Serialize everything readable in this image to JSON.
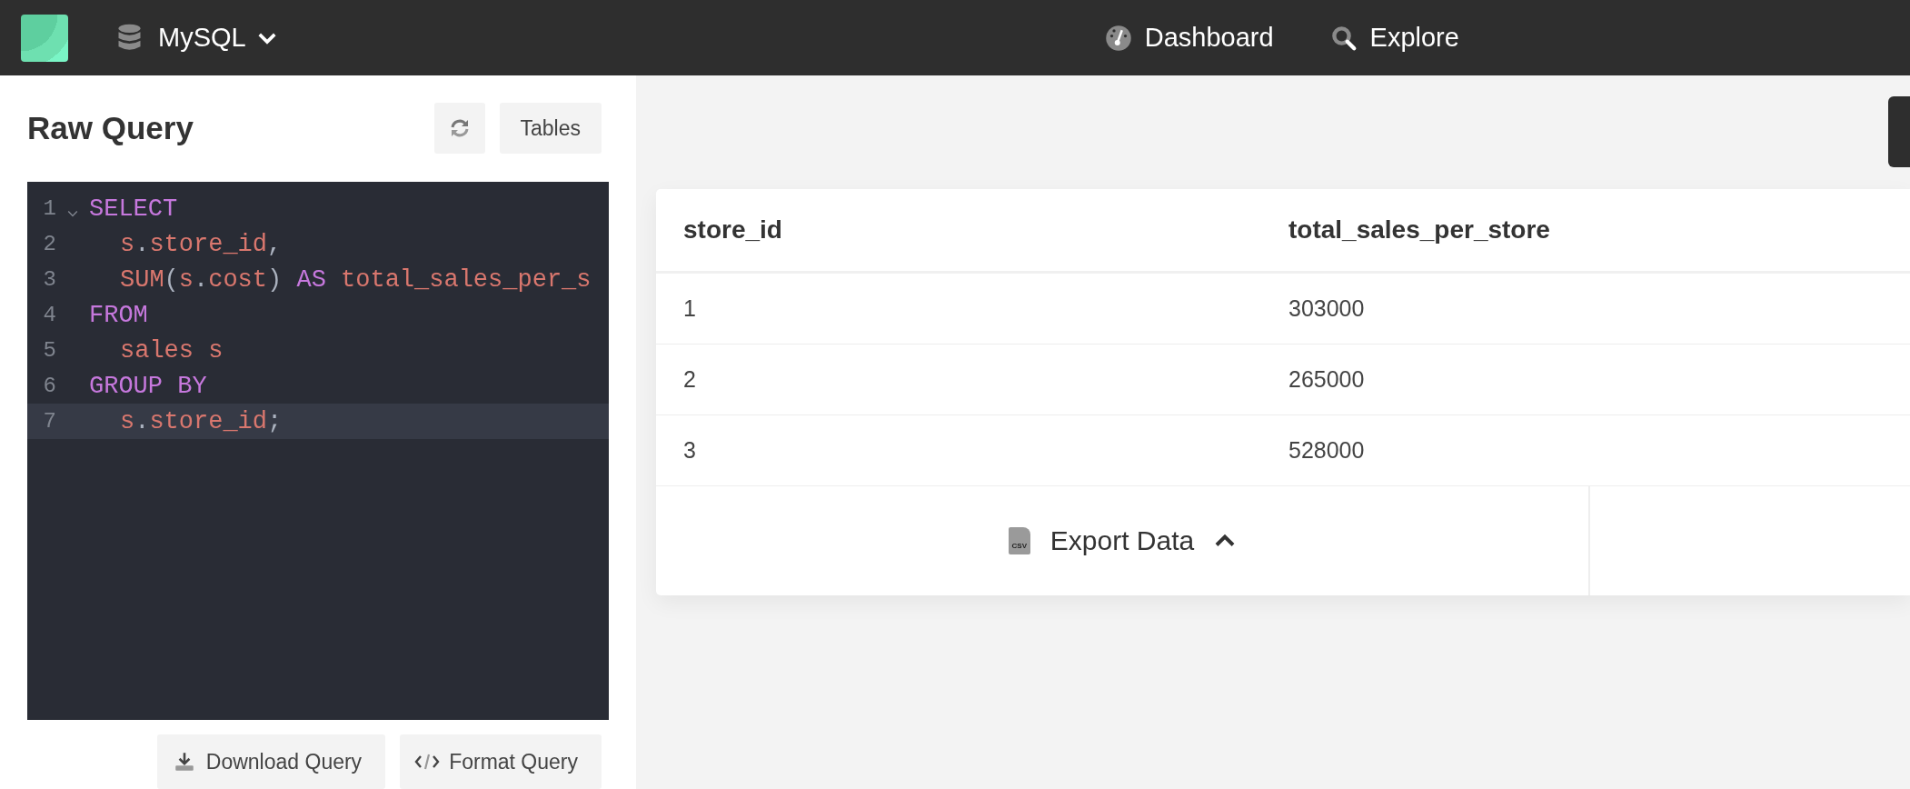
{
  "topbar": {
    "database": "MySQL",
    "nav": [
      {
        "label": "Dashboard",
        "kind": "dashboard"
      },
      {
        "label": "Explore",
        "kind": "explore"
      }
    ]
  },
  "query_panel": {
    "title": "Raw Query",
    "tables_button": "Tables",
    "editor": {
      "lines": [
        {
          "number": "1",
          "foldable": true,
          "active": false,
          "indented": false,
          "tokens": [
            {
              "kind": "keyword",
              "text": "SELECT"
            }
          ]
        },
        {
          "number": "2",
          "foldable": false,
          "active": false,
          "indented": true,
          "tokens": [
            {
              "kind": "ident",
              "text": "s"
            },
            {
              "kind": "punct",
              "text": "."
            },
            {
              "kind": "ident",
              "text": "store_id"
            },
            {
              "kind": "punct",
              "text": ","
            }
          ]
        },
        {
          "number": "3",
          "foldable": false,
          "active": false,
          "indented": true,
          "tokens": [
            {
              "kind": "ident",
              "text": "SUM"
            },
            {
              "kind": "punct",
              "text": "("
            },
            {
              "kind": "ident",
              "text": "s"
            },
            {
              "kind": "punct",
              "text": "."
            },
            {
              "kind": "ident",
              "text": "cost"
            },
            {
              "kind": "punct",
              "text": ") "
            },
            {
              "kind": "keyword",
              "text": "AS "
            },
            {
              "kind": "ident",
              "text": "total_sales_per_s"
            }
          ]
        },
        {
          "number": "4",
          "foldable": false,
          "active": false,
          "indented": false,
          "tokens": [
            {
              "kind": "keyword",
              "text": "FROM"
            }
          ]
        },
        {
          "number": "5",
          "foldable": false,
          "active": false,
          "indented": true,
          "tokens": [
            {
              "kind": "ident",
              "text": "sales s"
            }
          ]
        },
        {
          "number": "6",
          "foldable": false,
          "active": false,
          "indented": false,
          "tokens": [
            {
              "kind": "keyword",
              "text": "GROUP BY"
            }
          ]
        },
        {
          "number": "7",
          "foldable": false,
          "active": true,
          "indented": true,
          "tokens": [
            {
              "kind": "ident",
              "text": "s"
            },
            {
              "kind": "punct",
              "text": "."
            },
            {
              "kind": "ident",
              "text": "store_id"
            },
            {
              "kind": "punct",
              "text": ";"
            }
          ]
        }
      ]
    },
    "buttons": [
      {
        "label": "Download Query",
        "kind": "download"
      },
      {
        "label": "Format Query",
        "kind": "format"
      }
    ]
  },
  "results": {
    "columns": [
      "store_id",
      "total_sales_per_store"
    ],
    "rows": [
      [
        "1",
        "303000"
      ],
      [
        "2",
        "265000"
      ],
      [
        "3",
        "528000"
      ]
    ],
    "export": {
      "label": "Export Data",
      "icon_label": "CSV"
    }
  }
}
